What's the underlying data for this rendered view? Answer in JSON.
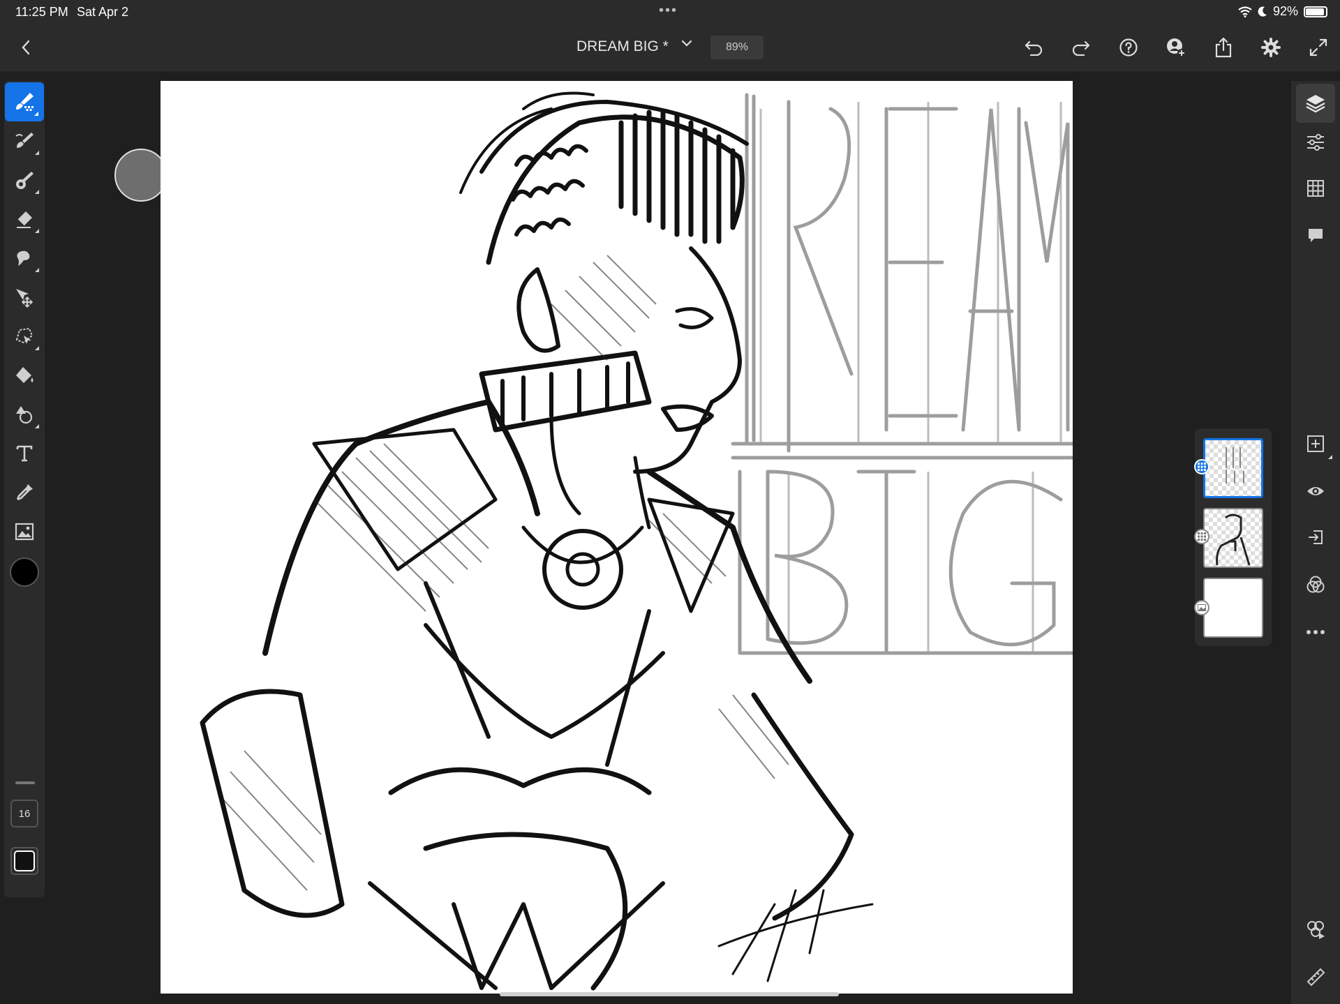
{
  "status_bar": {
    "time": "11:25 PM",
    "date": "Sat Apr 2",
    "center_dots": "•••",
    "battery": "92%"
  },
  "top_bar": {
    "back_icon": "chevron-left-icon",
    "document_title": "DREAM BIG *",
    "zoom": "89%",
    "actions": [
      "undo-icon",
      "redo-icon",
      "help-icon",
      "invite-icon",
      "share-icon",
      "settings-icon",
      "fullscreen-icon"
    ]
  },
  "left_toolbar": {
    "tools": [
      "brush-tool-icon",
      "smudge-tool-icon",
      "mixer-brush-icon",
      "eraser-icon",
      "liquify-icon",
      "transform-icon",
      "lasso-icon",
      "fill-icon",
      "shape-icon",
      "text-icon",
      "eyedropper-icon",
      "place-image-icon"
    ],
    "color": "#000000",
    "brush_size": "16",
    "opacity_color": "#111111"
  },
  "layers": {
    "count": 3,
    "selected": 0
  },
  "right_toolbar": {
    "tools": [
      "layers-icon",
      "layer-properties-icon",
      "grid-icon",
      "comments-icon",
      "add-layer-icon",
      "visibility-icon",
      "import-icon",
      "blend-modes-icon",
      "more-icon",
      "livestream-icon",
      "ruler-icon"
    ]
  },
  "colors": {
    "accent": "#1473e6",
    "panel": "#2b2b2b",
    "background": "#1f1f1f"
  }
}
